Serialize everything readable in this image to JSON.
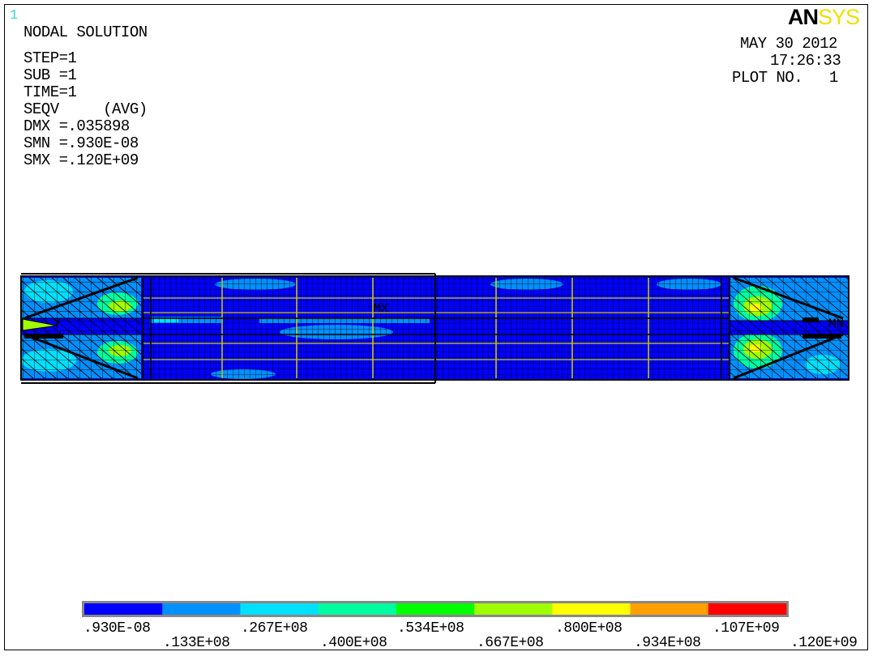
{
  "window_number": "1",
  "title": "NODAL SOLUTION",
  "info_lines": [
    "STEP=1",
    "SUB =1",
    "TIME=1",
    "SEQV     (AVG)",
    "DMX =.035898",
    "SMN =.930E-08",
    "SMX =.120E+09"
  ],
  "logo": {
    "part1": "AN",
    "part2": "SYS"
  },
  "date": "MAY 30 2012",
  "time": "17:26:33",
  "plot_no": "PLOT NO.   1",
  "model_labels": {
    "left_y": "Y",
    "mid_mx": "MX",
    "right_mn": "MN"
  },
  "legend": {
    "colors": [
      "#0000ff",
      "#0090ff",
      "#00e0ff",
      "#00ffa0",
      "#00ff00",
      "#a0ff00",
      "#ffff00",
      "#ffa000",
      "#ff0000"
    ],
    "labels_top": [
      ".930E-08",
      ".267E+08",
      ".534E+08",
      ".800E+08",
      ".107E+09"
    ],
    "labels_bottom": [
      ".133E+08",
      ".400E+08",
      ".667E+08",
      ".934E+08",
      ".120E+09"
    ]
  }
}
